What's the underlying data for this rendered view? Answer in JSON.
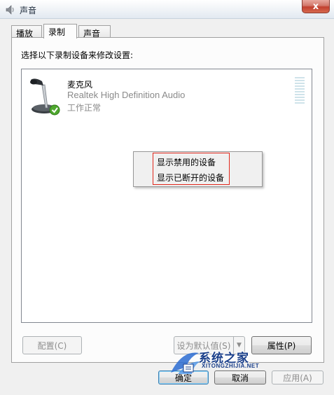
{
  "window": {
    "title": "声音",
    "close_label": "x"
  },
  "tabs": [
    {
      "label": "播放"
    },
    {
      "label": "录制"
    },
    {
      "label": "声音"
    }
  ],
  "recording": {
    "instruction": "选择以下录制设备来修改设置:",
    "device": {
      "name": "麦克风",
      "description": "Realtek High Definition Audio",
      "status": "工作正常",
      "icon": "microphone-icon"
    }
  },
  "context_menu": {
    "items": [
      {
        "label": "显示禁用的设备"
      },
      {
        "label": "显示已断开的设备"
      }
    ]
  },
  "buttons": {
    "configure": "配置(C)",
    "set_default": "设为默认值(S)",
    "properties": "属性(P)",
    "ok": "确定",
    "cancel": "取消",
    "apply": "应用(A)"
  },
  "watermark": {
    "title": "系统之家",
    "subtitle": "XITONGZHIJIA.NET"
  },
  "colors": {
    "highlight_border": "#e0281c",
    "close_button": "#c2402f",
    "watermark": "#1a3f8a"
  }
}
